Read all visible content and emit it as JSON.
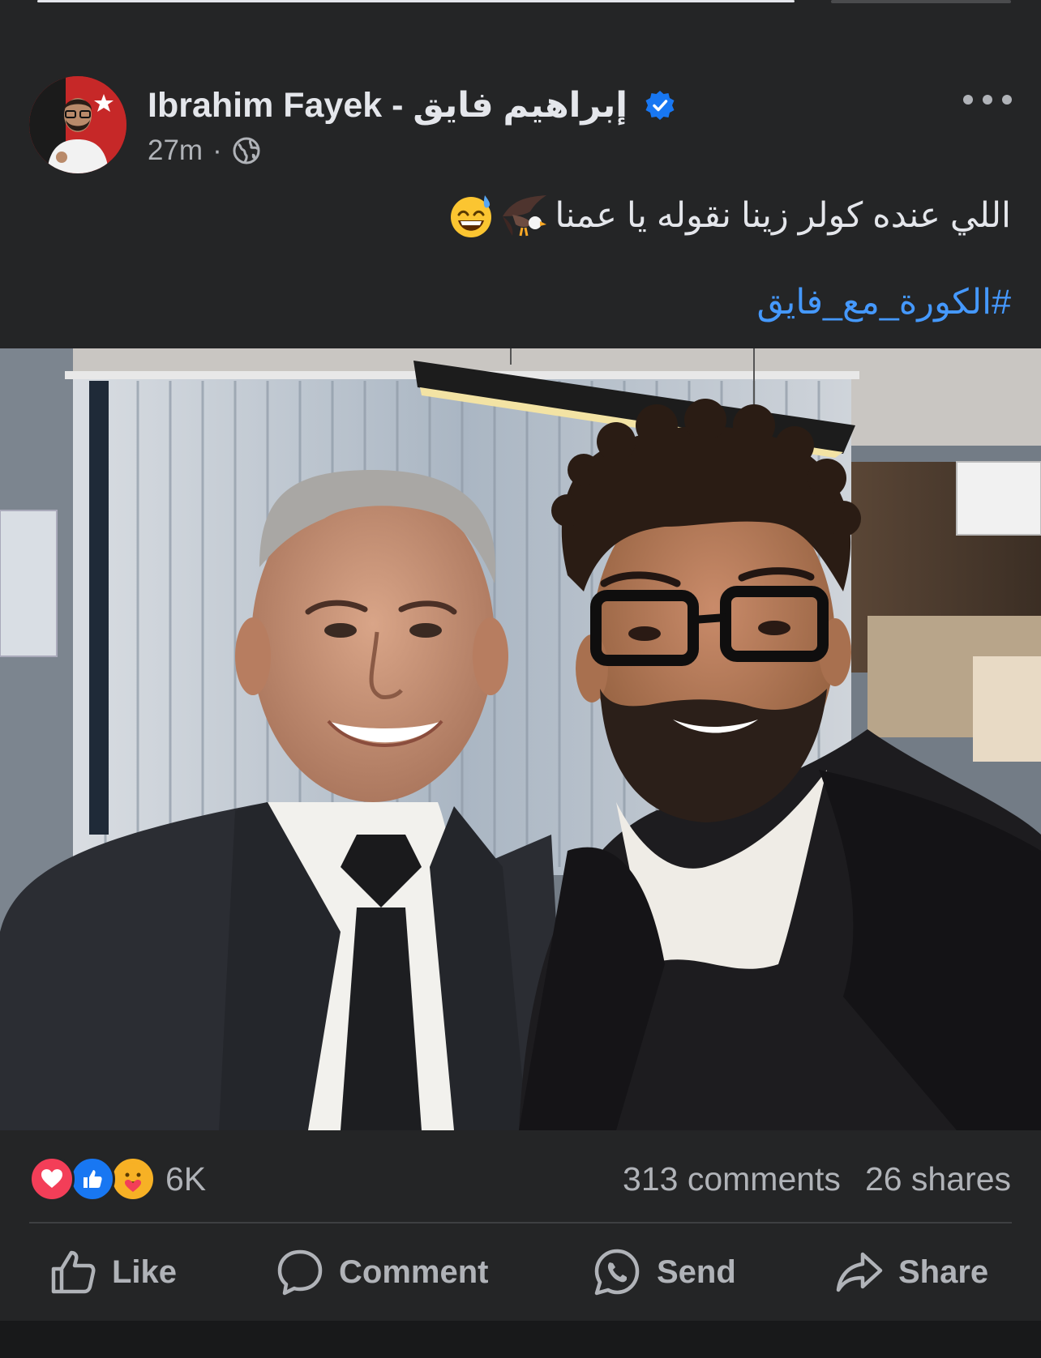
{
  "author": {
    "name": "Ibrahim Fayek - إبراهيم  فايق",
    "verified": true,
    "time": "27m",
    "separator": "·",
    "audience_icon": "globe-icon"
  },
  "post": {
    "caption": "اللي عنده كولر زينا نقوله يا عمنا",
    "caption_emojis": [
      "eagle-emoji",
      "grinning-sweat-emoji"
    ],
    "hashtag": "#الكورة_مع_فايق"
  },
  "engagement": {
    "reactions": [
      "love-reaction-icon",
      "like-reaction-icon",
      "care-reaction-icon"
    ],
    "reaction_count": "6K",
    "comments": "313 comments",
    "shares": "26 shares"
  },
  "actions": {
    "like": "Like",
    "comment": "Comment",
    "send": "Send",
    "share": "Share"
  },
  "colors": {
    "background": "#242526",
    "text_primary": "#e4e6eb",
    "text_secondary": "#b0b3b8",
    "link": "#4599ff",
    "verified": "#1877f2"
  }
}
